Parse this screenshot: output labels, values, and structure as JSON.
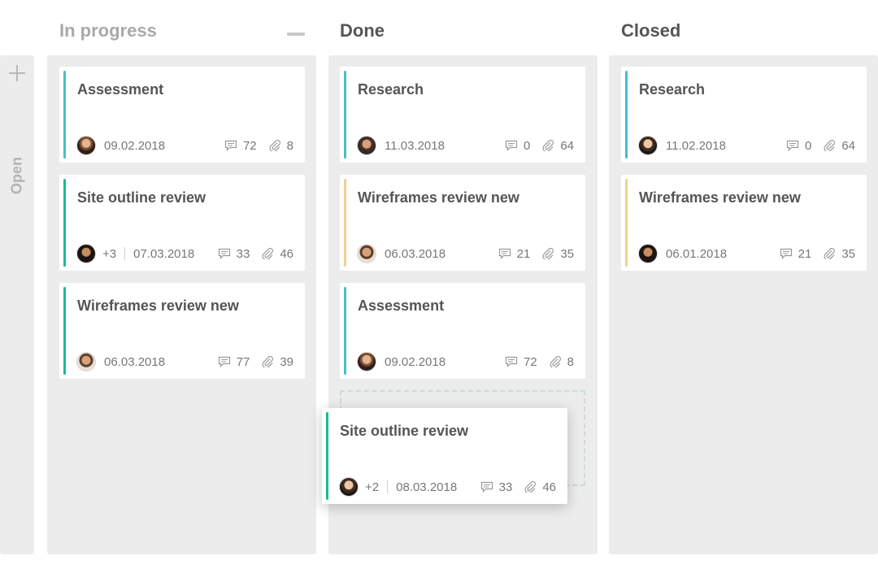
{
  "colors": {
    "teal": "#45bfcc",
    "green": "#1db896",
    "amber": "#f3d08d"
  },
  "collapsed_column": {
    "label": "Open",
    "add_icon": "plus-icon"
  },
  "columns": [
    {
      "title": "In progress",
      "minimize_icon": "minimize-icon",
      "cards": [
        {
          "title": "Assessment",
          "date": "09.02.2018",
          "comments": "72",
          "attachments": "8"
        },
        {
          "title": "Site outline review",
          "extra": "+3",
          "date": "07.03.2018",
          "comments": "33",
          "attachments": "46"
        },
        {
          "title": "Wireframes review  new",
          "date": "06.03.2018",
          "comments": "77",
          "attachments": "39"
        }
      ]
    },
    {
      "title": "Done",
      "cards": [
        {
          "title": "Research",
          "date": "11.03.2018",
          "comments": "0",
          "attachments": "64"
        },
        {
          "title": "Wireframes review  new",
          "date": "06.03.2018",
          "comments": "21",
          "attachments": "35"
        },
        {
          "title": "Assessment",
          "date": "09.02.2018",
          "comments": "72",
          "attachments": "8"
        }
      ]
    },
    {
      "title": "Closed",
      "cards": [
        {
          "title": "Research",
          "date": "11.02.2018",
          "comments": "0",
          "attachments": "64"
        },
        {
          "title": "Wireframes review  new",
          "date": "06.01.2018",
          "comments": "21",
          "attachments": "35"
        }
      ]
    }
  ],
  "dragging_card": {
    "title": "Site outline review",
    "extra": "+2",
    "date": "08.03.2018",
    "comments": "33",
    "attachments": "46"
  }
}
